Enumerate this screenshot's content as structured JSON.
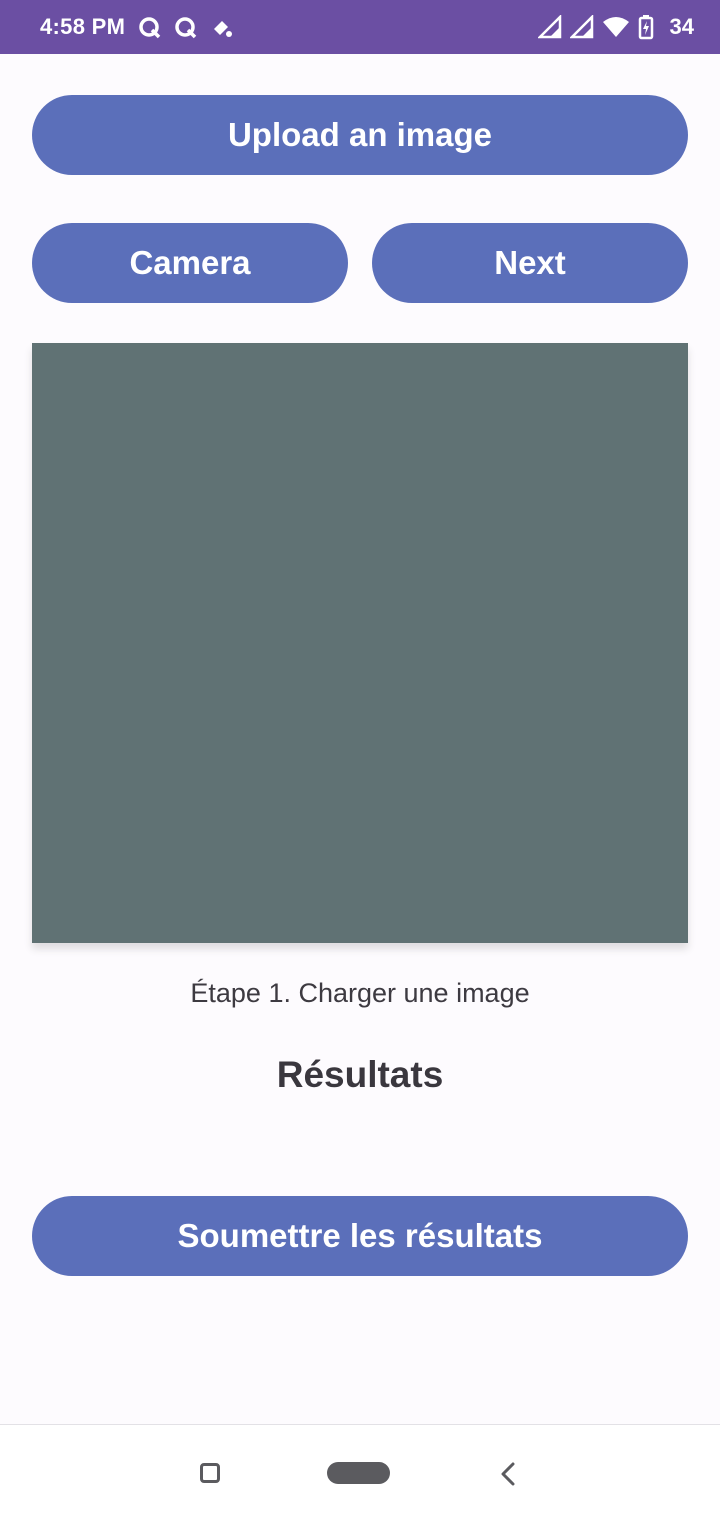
{
  "status_bar": {
    "time": "4:58 PM",
    "battery": "34",
    "colors": {
      "background": "#6b4fa3"
    },
    "icons": [
      "notification-q-icon",
      "notification-q-icon",
      "notification-app-icon",
      "cell-signal-icon",
      "cell-signal-icon",
      "wifi-icon",
      "battery-charging-icon"
    ]
  },
  "buttons": {
    "upload_label": "Upload an image",
    "camera_label": "Camera",
    "next_label": "Next",
    "submit_label": "Soumettre les résultats"
  },
  "main": {
    "step_text": "Étape 1. Charger une image",
    "results_title": "Résultats"
  },
  "colors": {
    "button": "#5b6fba",
    "image_placeholder": "#607274",
    "page_background": "#fdfbfe"
  },
  "nav_bar": {
    "icons": [
      "recents-icon",
      "home-pill-icon",
      "back-icon"
    ]
  }
}
